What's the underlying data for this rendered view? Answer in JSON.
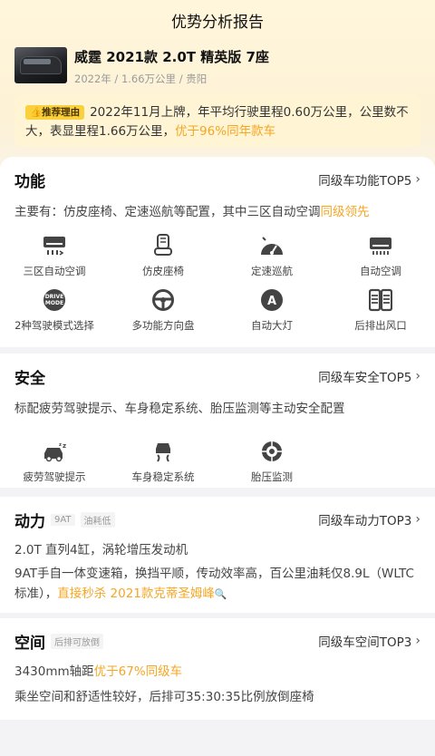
{
  "header": {
    "title": "优势分析报告"
  },
  "car": {
    "name": "威霆 2021款 2.0T 精英版 7座",
    "meta": "2022年 / 1.66万公里 / 贵阳"
  },
  "reason": {
    "tag": "推荐理由",
    "text": "2022年11月上牌，年平均行驶里程0.60万公里，公里数不大，表显里程1.66万公里，",
    "highlight": "优于96%同年款车"
  },
  "function": {
    "title": "功能",
    "link": "同级车功能TOP5",
    "desc_prefix": "主要有：仿皮座椅、定速巡航等配置，其中三区自动空调",
    "desc_highlight": "同级领先",
    "items": [
      {
        "label": "三区自动空调",
        "icon": "ac-three-zone-icon"
      },
      {
        "label": "仿皮座椅",
        "icon": "seat-icon"
      },
      {
        "label": "定速巡航",
        "icon": "cruise-icon"
      },
      {
        "label": "自动空调",
        "icon": "ac-icon"
      },
      {
        "label": "2种驾驶模式选择",
        "icon": "drive-mode-icon"
      },
      {
        "label": "多功能方向盘",
        "icon": "steering-wheel-icon"
      },
      {
        "label": "自动大灯",
        "icon": "auto-headlight-icon"
      },
      {
        "label": "后排出风口",
        "icon": "rear-vent-icon"
      }
    ]
  },
  "safety": {
    "title": "安全",
    "link": "同级车安全TOP5",
    "desc": "标配疲劳驾驶提示、车身稳定系统、胎压监测等主动安全配置",
    "items": [
      {
        "label": "疲劳驾驶提示",
        "icon": "fatigue-icon"
      },
      {
        "label": "车身稳定系统",
        "icon": "stability-icon"
      },
      {
        "label": "胎压监测",
        "icon": "tire-pressure-icon"
      }
    ]
  },
  "power": {
    "title": "动力",
    "tags": [
      "9AT",
      "油耗低"
    ],
    "link": "同级车动力TOP3",
    "line1": "2.0T 直列4缸，涡轮增压发动机",
    "line2": "9AT手自一体变速箱，换挡平顺，传动效率高，百公里油耗仅8.9L（WLTC标准），",
    "line2_highlight": "直接秒杀 2021款克蒂圣姆峰"
  },
  "space": {
    "title": "空间",
    "tag": "后排可放倒",
    "link": "同级车空间TOP3",
    "line1_prefix": "3430mm轴距",
    "line1_highlight": "优于67%同级车",
    "line2": "乘坐空间和舒适性较好，后排可35:30:35比例放倒座椅"
  },
  "colors": {
    "accent": "#f5a623",
    "tag": "#fbd03d",
    "icon": "#444444"
  }
}
